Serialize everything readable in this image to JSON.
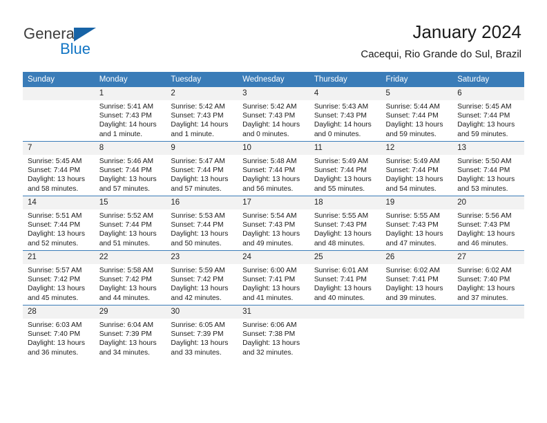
{
  "brand": {
    "name_dark": "General",
    "name_blue": "Blue",
    "accent_color": "#1275c4",
    "triangle_color": "#1763a6"
  },
  "header": {
    "title": "January 2024",
    "subtitle": "Cacequi, Rio Grande do Sul, Brazil"
  },
  "calendar": {
    "header_bg": "#3a7cb8",
    "daynum_bg": "#f2f2f2",
    "weekday_headers": [
      "Sunday",
      "Monday",
      "Tuesday",
      "Wednesday",
      "Thursday",
      "Friday",
      "Saturday"
    ],
    "weeks": [
      [
        {
          "day": "",
          "sunrise": "",
          "sunset": "",
          "daylight": "",
          "empty": true
        },
        {
          "day": "1",
          "sunrise": "Sunrise: 5:41 AM",
          "sunset": "Sunset: 7:43 PM",
          "daylight": "Daylight: 14 hours and 1 minute."
        },
        {
          "day": "2",
          "sunrise": "Sunrise: 5:42 AM",
          "sunset": "Sunset: 7:43 PM",
          "daylight": "Daylight: 14 hours and 1 minute."
        },
        {
          "day": "3",
          "sunrise": "Sunrise: 5:42 AM",
          "sunset": "Sunset: 7:43 PM",
          "daylight": "Daylight: 14 hours and 0 minutes."
        },
        {
          "day": "4",
          "sunrise": "Sunrise: 5:43 AM",
          "sunset": "Sunset: 7:43 PM",
          "daylight": "Daylight: 14 hours and 0 minutes."
        },
        {
          "day": "5",
          "sunrise": "Sunrise: 5:44 AM",
          "sunset": "Sunset: 7:44 PM",
          "daylight": "Daylight: 13 hours and 59 minutes."
        },
        {
          "day": "6",
          "sunrise": "Sunrise: 5:45 AM",
          "sunset": "Sunset: 7:44 PM",
          "daylight": "Daylight: 13 hours and 59 minutes."
        }
      ],
      [
        {
          "day": "7",
          "sunrise": "Sunrise: 5:45 AM",
          "sunset": "Sunset: 7:44 PM",
          "daylight": "Daylight: 13 hours and 58 minutes."
        },
        {
          "day": "8",
          "sunrise": "Sunrise: 5:46 AM",
          "sunset": "Sunset: 7:44 PM",
          "daylight": "Daylight: 13 hours and 57 minutes."
        },
        {
          "day": "9",
          "sunrise": "Sunrise: 5:47 AM",
          "sunset": "Sunset: 7:44 PM",
          "daylight": "Daylight: 13 hours and 57 minutes."
        },
        {
          "day": "10",
          "sunrise": "Sunrise: 5:48 AM",
          "sunset": "Sunset: 7:44 PM",
          "daylight": "Daylight: 13 hours and 56 minutes."
        },
        {
          "day": "11",
          "sunrise": "Sunrise: 5:49 AM",
          "sunset": "Sunset: 7:44 PM",
          "daylight": "Daylight: 13 hours and 55 minutes."
        },
        {
          "day": "12",
          "sunrise": "Sunrise: 5:49 AM",
          "sunset": "Sunset: 7:44 PM",
          "daylight": "Daylight: 13 hours and 54 minutes."
        },
        {
          "day": "13",
          "sunrise": "Sunrise: 5:50 AM",
          "sunset": "Sunset: 7:44 PM",
          "daylight": "Daylight: 13 hours and 53 minutes."
        }
      ],
      [
        {
          "day": "14",
          "sunrise": "Sunrise: 5:51 AM",
          "sunset": "Sunset: 7:44 PM",
          "daylight": "Daylight: 13 hours and 52 minutes."
        },
        {
          "day": "15",
          "sunrise": "Sunrise: 5:52 AM",
          "sunset": "Sunset: 7:44 PM",
          "daylight": "Daylight: 13 hours and 51 minutes."
        },
        {
          "day": "16",
          "sunrise": "Sunrise: 5:53 AM",
          "sunset": "Sunset: 7:44 PM",
          "daylight": "Daylight: 13 hours and 50 minutes."
        },
        {
          "day": "17",
          "sunrise": "Sunrise: 5:54 AM",
          "sunset": "Sunset: 7:43 PM",
          "daylight": "Daylight: 13 hours and 49 minutes."
        },
        {
          "day": "18",
          "sunrise": "Sunrise: 5:55 AM",
          "sunset": "Sunset: 7:43 PM",
          "daylight": "Daylight: 13 hours and 48 minutes."
        },
        {
          "day": "19",
          "sunrise": "Sunrise: 5:55 AM",
          "sunset": "Sunset: 7:43 PM",
          "daylight": "Daylight: 13 hours and 47 minutes."
        },
        {
          "day": "20",
          "sunrise": "Sunrise: 5:56 AM",
          "sunset": "Sunset: 7:43 PM",
          "daylight": "Daylight: 13 hours and 46 minutes."
        }
      ],
      [
        {
          "day": "21",
          "sunrise": "Sunrise: 5:57 AM",
          "sunset": "Sunset: 7:42 PM",
          "daylight": "Daylight: 13 hours and 45 minutes."
        },
        {
          "day": "22",
          "sunrise": "Sunrise: 5:58 AM",
          "sunset": "Sunset: 7:42 PM",
          "daylight": "Daylight: 13 hours and 44 minutes."
        },
        {
          "day": "23",
          "sunrise": "Sunrise: 5:59 AM",
          "sunset": "Sunset: 7:42 PM",
          "daylight": "Daylight: 13 hours and 42 minutes."
        },
        {
          "day": "24",
          "sunrise": "Sunrise: 6:00 AM",
          "sunset": "Sunset: 7:41 PM",
          "daylight": "Daylight: 13 hours and 41 minutes."
        },
        {
          "day": "25",
          "sunrise": "Sunrise: 6:01 AM",
          "sunset": "Sunset: 7:41 PM",
          "daylight": "Daylight: 13 hours and 40 minutes."
        },
        {
          "day": "26",
          "sunrise": "Sunrise: 6:02 AM",
          "sunset": "Sunset: 7:41 PM",
          "daylight": "Daylight: 13 hours and 39 minutes."
        },
        {
          "day": "27",
          "sunrise": "Sunrise: 6:02 AM",
          "sunset": "Sunset: 7:40 PM",
          "daylight": "Daylight: 13 hours and 37 minutes."
        }
      ],
      [
        {
          "day": "28",
          "sunrise": "Sunrise: 6:03 AM",
          "sunset": "Sunset: 7:40 PM",
          "daylight": "Daylight: 13 hours and 36 minutes."
        },
        {
          "day": "29",
          "sunrise": "Sunrise: 6:04 AM",
          "sunset": "Sunset: 7:39 PM",
          "daylight": "Daylight: 13 hours and 34 minutes."
        },
        {
          "day": "30",
          "sunrise": "Sunrise: 6:05 AM",
          "sunset": "Sunset: 7:39 PM",
          "daylight": "Daylight: 13 hours and 33 minutes."
        },
        {
          "day": "31",
          "sunrise": "Sunrise: 6:06 AM",
          "sunset": "Sunset: 7:38 PM",
          "daylight": "Daylight: 13 hours and 32 minutes."
        },
        {
          "day": "",
          "sunrise": "",
          "sunset": "",
          "daylight": "",
          "empty": true
        },
        {
          "day": "",
          "sunrise": "",
          "sunset": "",
          "daylight": "",
          "empty": true
        },
        {
          "day": "",
          "sunrise": "",
          "sunset": "",
          "daylight": "",
          "empty": true
        }
      ]
    ]
  }
}
